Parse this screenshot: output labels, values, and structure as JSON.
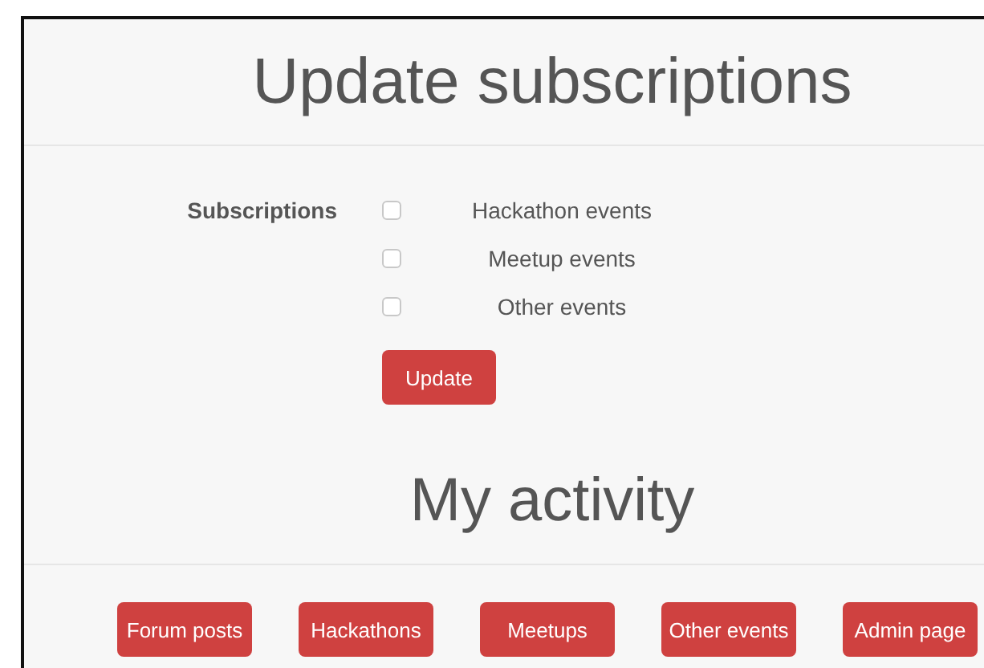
{
  "subscriptions": {
    "title": "Update subscriptions",
    "field_label": "Subscriptions",
    "options": [
      {
        "label": "Hackathon events",
        "checked": false
      },
      {
        "label": "Meetup events",
        "checked": false
      },
      {
        "label": "Other events",
        "checked": false
      }
    ],
    "submit": "Update"
  },
  "activity": {
    "title": "My activity",
    "links": [
      "Forum posts",
      "Hackathons",
      "Meetups",
      "Other events",
      "Admin page"
    ]
  }
}
